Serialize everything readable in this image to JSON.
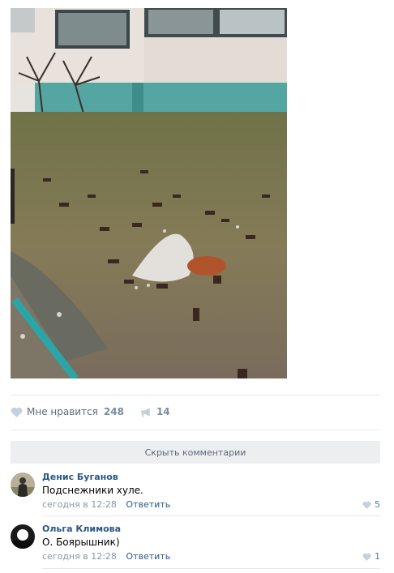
{
  "post": {
    "photo": {
      "icon": "photo-trash-bottles"
    },
    "likes": {
      "label": "Мне нравится",
      "count": "248",
      "icon": "heart-icon"
    },
    "shares": {
      "count": "14",
      "icon": "megaphone-icon"
    }
  },
  "comments_toggle": {
    "label": "Скрыть комментарии"
  },
  "comments": [
    {
      "author": "Денис Буганов",
      "text": "Подснежники хуле.",
      "time": "сегодня в 12:28",
      "reply": "Ответить",
      "likes": "5"
    },
    {
      "author": "Ольга Климова",
      "text": "О. Боярышник)",
      "time": "сегодня в 12:28",
      "reply": "Ответить",
      "likes": "1"
    }
  ],
  "colors": {
    "link": "#2a5885",
    "muted": "#8a96a3",
    "separator": "#e7e8ec",
    "button_bg": "#edeef0"
  }
}
